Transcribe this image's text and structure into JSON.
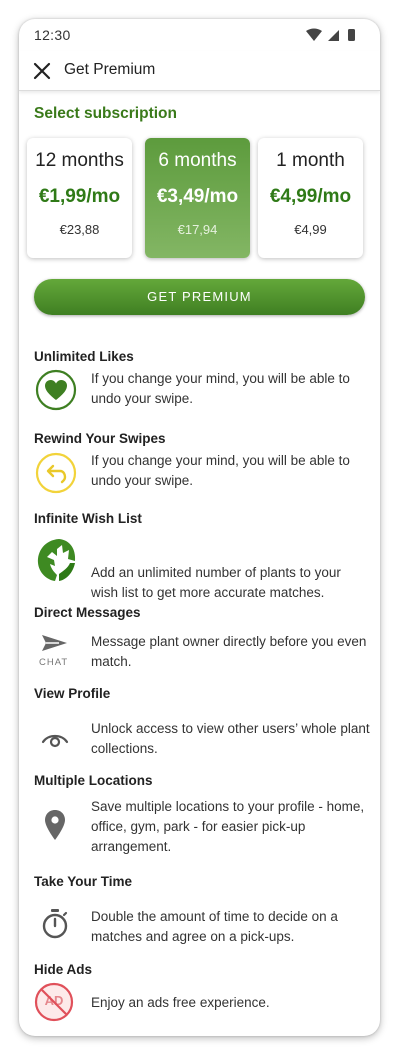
{
  "status": {
    "time": "12:30"
  },
  "header": {
    "title": "Get Premium"
  },
  "section_title": "Select subscription",
  "plans": [
    {
      "duration": "12 months",
      "price": "€1,99/mo",
      "total": "€23,88",
      "selected": false
    },
    {
      "duration": "6 months",
      "price": "€3,49/mo",
      "total": "€17,94",
      "selected": true
    },
    {
      "duration": "1 month",
      "price": "€4,99/mo",
      "total": "€4,99",
      "selected": false
    }
  ],
  "cta_label": "GET PREMIUM",
  "features": [
    {
      "title": "Unlimited Likes",
      "description": "If you change your mind, you will be able to undo your swipe.",
      "icon": "heart-icon"
    },
    {
      "title": "Rewind Your Swipes",
      "description": "If you change your mind, you will be able to undo your swipe.",
      "icon": "rewind-icon"
    },
    {
      "title": "Infinite Wish List",
      "description": "Add an unlimited number of plants to your wish list to get more accurate matches.",
      "icon": "monstera-leaf-icon"
    },
    {
      "title": "Direct Messages",
      "description": "Message plant owner directly before you even match.",
      "icon": "chat-icon",
      "icon_text": "CHAT"
    },
    {
      "title": "View Profile",
      "description": "Unlock access to view other users’ whole plant collections.",
      "icon": "eye-icon"
    },
    {
      "title": "Multiple Locations",
      "description": "Save multiple locations to your profile - home, office, gym, park - for easier pick-up arrangement.",
      "icon": "location-pin-icon"
    },
    {
      "title": "Take Your Time",
      "description": "Double the amount of time to decide on a matches and agree on a pick-ups.",
      "icon": "stopwatch-icon"
    },
    {
      "title": "Hide Ads",
      "description": "Enjoy an ads free experience.",
      "icon": "no-ads-icon",
      "icon_text": "AD"
    }
  ],
  "colors": {
    "primary_green": "#3f7f22",
    "price_green": "#2f7a17",
    "selected_plan": "#6aa548",
    "rewind_yellow": "#f2d33a",
    "no_ads_red": "#e0505a"
  }
}
